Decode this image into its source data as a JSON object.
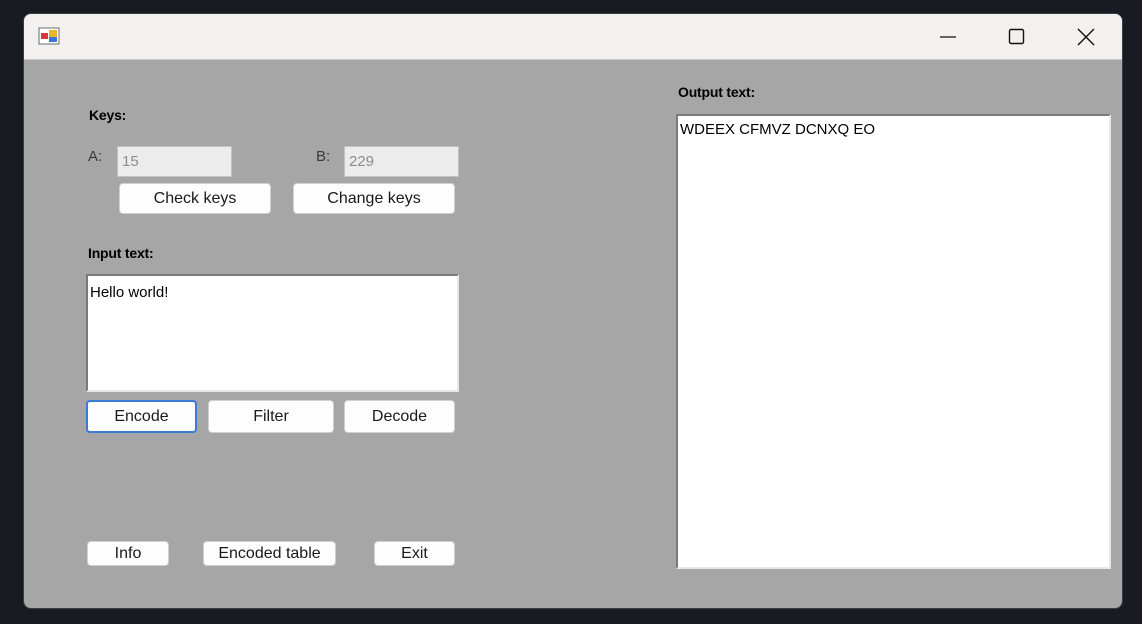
{
  "window": {
    "controls": {
      "minimize_icon": "minimize-icon",
      "maximize_icon": "maximize-icon",
      "close_icon": "close-icon"
    }
  },
  "keys": {
    "heading": "Keys:",
    "a_label": "A:",
    "a_value": "15",
    "b_label": "B:",
    "b_value": "229",
    "check_button": "Check keys",
    "change_button": "Change keys"
  },
  "input": {
    "heading": "Input text:",
    "value": "Hello world!"
  },
  "actions": {
    "encode": "Encode",
    "filter": "Filter",
    "decode": "Decode"
  },
  "bottom": {
    "info": "Info",
    "encoded_table": "Encoded table",
    "exit": "Exit"
  },
  "output": {
    "heading": "Output text:",
    "value": "WDEEX CFMVZ DCNXQ EO"
  }
}
